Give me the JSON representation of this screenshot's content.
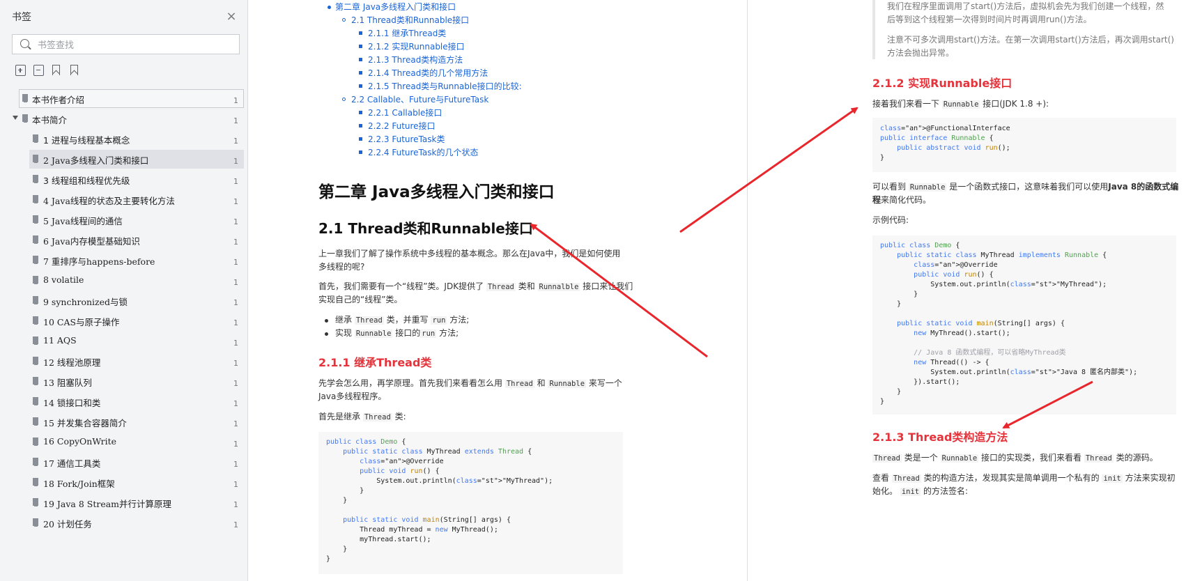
{
  "sidebar": {
    "title": "书签",
    "close_label": "×",
    "search_placeholder": "书签查找",
    "items": [
      {
        "label": "本书作者介绍",
        "page": "1"
      },
      {
        "label": "本书简介",
        "page": "1"
      },
      {
        "label": "1 进程与线程基本概念",
        "page": "1"
      },
      {
        "label": "2 Java多线程入门类和接口",
        "page": "1"
      },
      {
        "label": "3 线程组和线程优先级",
        "page": "1"
      },
      {
        "label": "4 Java线程的状态及主要转化方法",
        "page": "1"
      },
      {
        "label": "5 Java线程间的通信",
        "page": "1"
      },
      {
        "label": "6 Java内存模型基础知识",
        "page": "1"
      },
      {
        "label": "7 重排序与happens-before",
        "page": "1"
      },
      {
        "label": "8 volatile",
        "page": "1"
      },
      {
        "label": "9 synchronized与锁",
        "page": "1"
      },
      {
        "label": "10 CAS与原子操作",
        "page": "1"
      },
      {
        "label": "11 AQS",
        "page": "1"
      },
      {
        "label": "12 线程池原理",
        "page": "1"
      },
      {
        "label": "13 阻塞队列",
        "page": "1"
      },
      {
        "label": "14 锁接口和类",
        "page": "1"
      },
      {
        "label": "15 并发集合容器简介",
        "page": "1"
      },
      {
        "label": "16 CopyOnWrite",
        "page": "1"
      },
      {
        "label": "17 通信工具类",
        "page": "1"
      },
      {
        "label": "18 Fork/Join框架",
        "page": "1"
      },
      {
        "label": "19 Java 8 Stream并行计算原理",
        "page": "1"
      },
      {
        "label": "20 计划任务",
        "page": "1"
      }
    ]
  },
  "left_page": {
    "toc": [
      "第二章 Java多线程入门类和接口",
      "2.1 Thread类和Runnable接口",
      "2.1.1 继承Thread类",
      "2.1.2 实现Runnable接口",
      "2.1.3 Thread类构造方法",
      "2.1.4 Thread类的几个常用方法",
      "2.1.5 Thread类与Runnable接口的比较:",
      "2.2 Callable、Future与FutureTask",
      "2.2.1 Callable接口",
      "2.2.2 Future接口",
      "2.2.3 FutureTask类",
      "2.2.4 FutureTask的几个状态"
    ],
    "chapter_title": "第二章 Java多线程入门类和接口",
    "section_title": "2.1 Thread类和Runnable接口",
    "para1_line1": "上一章我们了解了操作系统中多线程的基本概念。那么在Java中，我们是如何使用",
    "para1_line2": "多线程的呢?",
    "para2_line1_a": "首先，我们需要有一个“线程”类。JDK提供了",
    "para2_line1_code1": "Thread",
    "para2_line1_b": "类和",
    "para2_line1_code2": "Runnalble",
    "para2_line1_c": "接口来让我们",
    "para2_line2": "实现自己的“线程”类。",
    "bullet1_a": "继承",
    "bullet1_code1": "Thread",
    "bullet1_b": "类，并重写",
    "bullet1_code2": "run",
    "bullet1_c": "方法;",
    "bullet2_a": "实现",
    "bullet2_code1": "Runnable",
    "bullet2_b": "接口的",
    "bullet2_code2": "run",
    "bullet2_c": "方法;",
    "sub_title": "2.1.1 继承Thread类",
    "para3_line1_a": "先学会怎么用，再学原理。首先我们来看看怎么用",
    "para3_code1": "Thread",
    "para3_line1_b": "和",
    "para3_code2": "Runnable",
    "para3_line1_c": "来写一个",
    "para3_line2": "Java多线程程序。",
    "para4_a": "首先是继承",
    "para4_code": "Thread",
    "para4_b": "类:",
    "code_lines": [
      "public class Demo {",
      "    public static class MyThread extends Thread {",
      "        @Override",
      "        public void run() {",
      "            System.out.println(\"MyThread\");",
      "        }",
      "    }",
      "",
      "    public static void main(String[] args) {",
      "        Thread myThread = new MyThread();",
      "        myThread.start();",
      "    }",
      "}"
    ]
  },
  "right_page": {
    "quote_line1": "我们在程序里面调用了start()方法后，虚拟机会先为我们创建一个线程，然",
    "quote_line2": "后等到这个线程第一次得到时间片时再调用run()方法。",
    "quote_line3": "注意不可多次调用start()方法。在第一次调用start()方法后，再次调用start()",
    "quote_line4": "方法会抛出异常。",
    "sub_title_212": "2.1.2 实现Runnable接口",
    "p1_a": "接着我们来看一下",
    "p1_code": "Runnable",
    "p1_b": "接口(JDK 1.8 +):",
    "code1_lines": [
      "@FunctionalInterface",
      "public interface Runnable {",
      "    public abstract void run();",
      "}"
    ],
    "p2_a": "可以看到",
    "p2_code": "Runnable",
    "p2_b": "是一个函数式接口，这意味着我们可以使用",
    "p2_bold": "Java 8的函数式编",
    "p2_line2_bold": "程",
    "p2_line2": "来简化代码。",
    "p3": "示例代码:",
    "code2_lines": [
      "public class Demo {",
      "    public static class MyThread implements Runnable {",
      "        @Override",
      "        public void run() {",
      "            System.out.println(\"MyThread\");",
      "        }",
      "    }",
      "",
      "    public static void main(String[] args) {",
      "        new MyThread().start();",
      "",
      "        // Java 8 函数式编程，可以省略MyThread类",
      "        new Thread(() -> {",
      "            System.out.println(\"Java 8 匿名内部类\");",
      "        }).start();",
      "    }",
      "}"
    ],
    "sub_title_213": "2.1.3 Thread类构造方法",
    "p4_code1": "Thread",
    "p4_a": "类是一个",
    "p4_code2": "Runnable",
    "p4_b": "接口的实现类，我们来看看",
    "p4_code3": "Thread",
    "p4_c": "类的源码。",
    "p5_a": "查看",
    "p5_code1": "Thread",
    "p5_b": "类的构造方法，发现其实是简单调用一个私有的",
    "p5_code2": "init",
    "p5_c": "方法来实现初",
    "p5_line2_a": "始化。",
    "p5_line2_code": "init",
    "p5_line2_b": "的方法签名:"
  },
  "colors": {
    "link": "#1a64d6",
    "heading_red": "#e5333b",
    "arrow_red": "#e8262c",
    "sidebar_bg": "#f3f4f6",
    "selected_bg": "#dfe1e6"
  }
}
